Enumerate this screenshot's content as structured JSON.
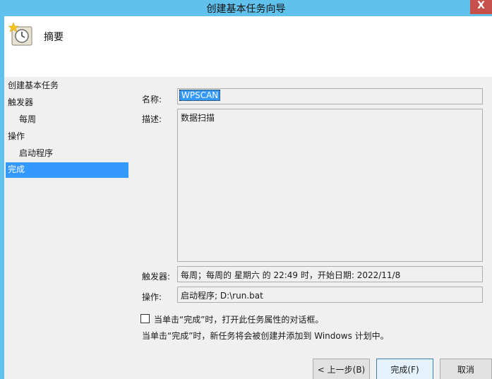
{
  "window": {
    "title": "创建基本任务向导",
    "close_glyph": "X"
  },
  "header": {
    "heading": "摘要",
    "icon": "clock-task-icon"
  },
  "nav": {
    "items": [
      {
        "label": "创建基本任务",
        "level": 1,
        "selected": false
      },
      {
        "label": "触发器",
        "level": 1,
        "selected": false
      },
      {
        "label": "每周",
        "level": 2,
        "selected": false
      },
      {
        "label": "操作",
        "level": 1,
        "selected": false
      },
      {
        "label": "启动程序",
        "level": 2,
        "selected": false
      },
      {
        "label": "完成",
        "level": 1,
        "selected": true
      }
    ]
  },
  "form": {
    "name_label": "名称:",
    "name_value": "WPSCAN",
    "desc_label": "描述:",
    "desc_value": "数据扫描",
    "trigger_label": "触发器:",
    "trigger_value": "每周；每周的 星期六 的 22:49 时，开始日期: 2022/11/8",
    "action_label": "操作:",
    "action_value": "启动程序; D:\\run.bat",
    "checkbox_label": "当单击“完成”时，打开此任务属性的对话框。",
    "checkbox_checked": false,
    "note": "当单击“完成”时，新任务将会被创建并添加到 Windows 计划中。"
  },
  "buttons": {
    "back": "< 上一步(B)",
    "finish": "完成(F)",
    "cancel": "取消"
  },
  "colors": {
    "titlebar": "#5fc1ec",
    "close": "#c7504b",
    "selection": "#3399ff"
  }
}
